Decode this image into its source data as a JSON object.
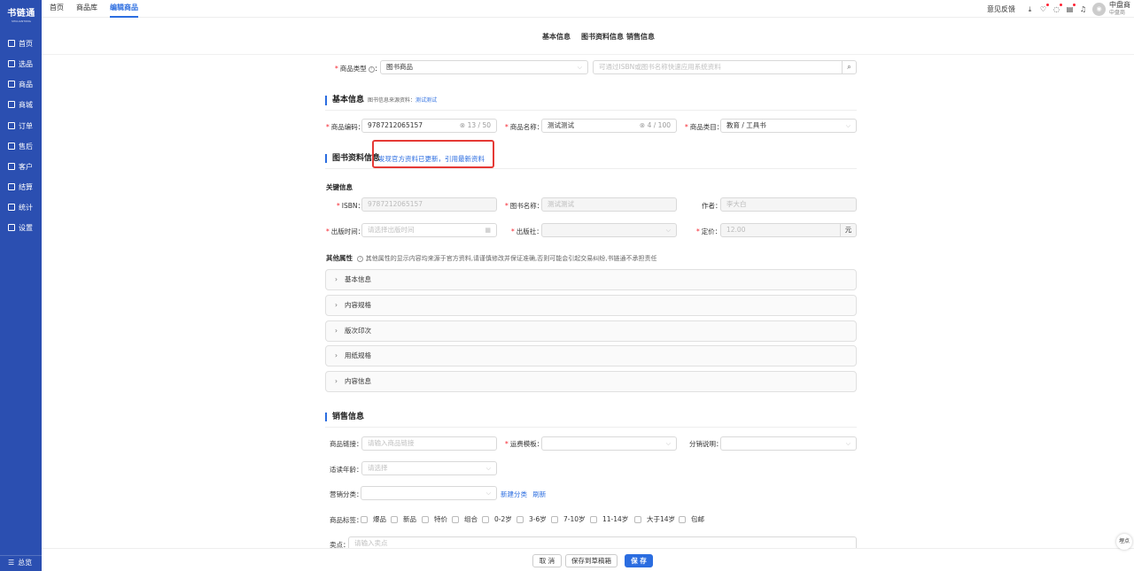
{
  "sidebar": {
    "logo": "书链通",
    "logo_sub": "SHULIANTONG",
    "items": [
      {
        "label": "首页",
        "icon": "home-icon"
      },
      {
        "label": "选品",
        "icon": "select-icon"
      },
      {
        "label": "商品",
        "icon": "goods-icon"
      },
      {
        "label": "商城",
        "icon": "mall-icon"
      },
      {
        "label": "订单",
        "icon": "order-icon"
      },
      {
        "label": "售后",
        "icon": "service-icon"
      },
      {
        "label": "客户",
        "icon": "customer-icon"
      },
      {
        "label": "结算",
        "icon": "settle-icon"
      },
      {
        "label": "统计",
        "icon": "stats-icon"
      },
      {
        "label": "设置",
        "icon": "settings-icon"
      }
    ],
    "bottom": "总览"
  },
  "topbar": {
    "tabs": [
      "首页",
      "商品库",
      "编辑商品"
    ],
    "active_tab": "编辑商品",
    "feedback": "意见反馈",
    "user_name": "中盘商",
    "user_sub": "中盘商"
  },
  "anchors": [
    "基本信息",
    "图书资料信息",
    "销售信息"
  ],
  "product_type": {
    "label": "商品类型",
    "value": "图书商品",
    "search_placeholder": "可通过ISBN或图书名称快速应用系统资料"
  },
  "basic": {
    "title": "基本信息",
    "note_prefix": "图书信息来源资料：",
    "note_link": "测试测试",
    "code_label": "商品编码：",
    "code_value": "9787212065157",
    "code_count": "13 / 50",
    "name_label": "商品名称：",
    "name_value": "测试测试",
    "name_count": "4 / 100",
    "category_label": "商品类目：",
    "category_value": "教育 / 工具书"
  },
  "book": {
    "title": "图书资料信息",
    "update_link": "发现官方资料已更新，引用最新资料",
    "key_title": "关键信息",
    "isbn_label": "ISBN：",
    "isbn_value": "9787212065157",
    "bookname_label": "图书名称：",
    "bookname_value": "测试测试",
    "author_label": "作者：",
    "author_value": "李大白",
    "pubdate_label": "出版时间：",
    "pubdate_placeholder": "请选择出版时间",
    "publisher_label": "出版社：",
    "price_label": "定价：",
    "price_value": "12.00",
    "price_unit": "元",
    "other_title": "其他属性",
    "other_note": "其他属性的显示内容均来源于官方资料,请谨慎修改并保证准确,否则可能会引起交易纠纷,书链通不承担责任",
    "panels": [
      "基本信息",
      "内容规格",
      "版次印次",
      "用纸规格",
      "内容信息"
    ]
  },
  "sales": {
    "title": "销售信息",
    "link_label": "商品链接：",
    "link_placeholder": "请输入商品链接",
    "shipping_label": "运费模板：",
    "dist_label": "分销说明：",
    "age_label": "适读年龄：",
    "age_placeholder": "请选择",
    "marketing_label": "营销分类：",
    "new_category": "新建分类",
    "refresh": "刷新",
    "tags_label": "商品标签：",
    "tags": [
      "爆品",
      "新品",
      "特价",
      "组合",
      "0-2岁",
      "3-6岁",
      "7-10岁",
      "11-14岁",
      "大于14岁",
      "包邮"
    ],
    "selling_label": "卖点：",
    "selling_placeholder": "请输入卖点"
  },
  "footer": {
    "cancel": "取 消",
    "draft": "保存到草稿箱",
    "save": "保 存"
  },
  "float_btn": "埋点"
}
